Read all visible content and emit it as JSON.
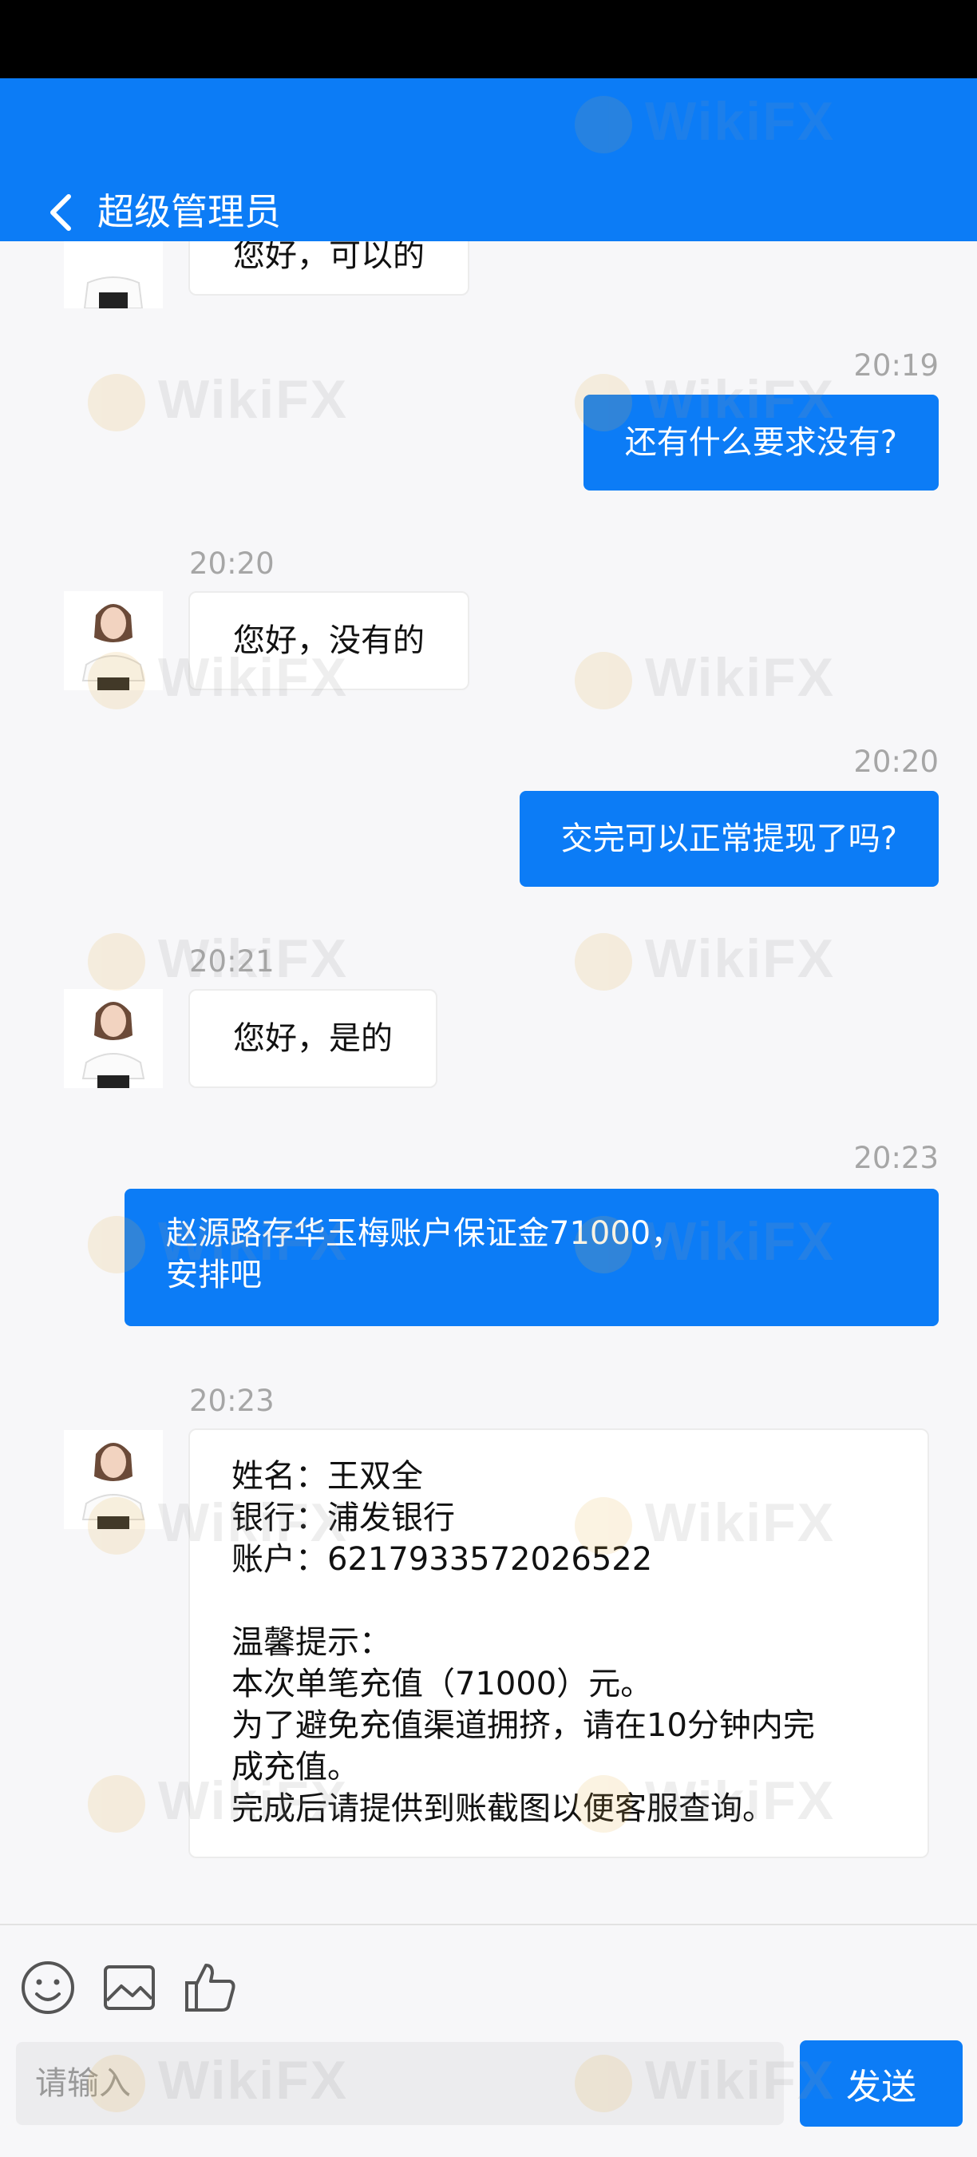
{
  "header": {
    "title": "超级管理员"
  },
  "messages": [
    {
      "side": "in",
      "time": "",
      "text": "您好，可以的"
    },
    {
      "side": "out",
      "time": "20:19",
      "text": "还有什么要求没有?"
    },
    {
      "side": "in",
      "time": "20:20",
      "text": "您好，没有的"
    },
    {
      "side": "out",
      "time": "20:20",
      "text": "交完可以正常提现了吗?"
    },
    {
      "side": "in",
      "time": "20:21",
      "text": "您好，是的"
    },
    {
      "side": "out",
      "time": "20:23",
      "text": "赵源路存华玉梅账户保证金71000，\n安排吧"
    },
    {
      "side": "in",
      "time": "20:23",
      "text": "姓名：王双全\n银行：浦发银行\n账户：6217933572026522\n\n温馨提示：\n本次单笔充值（71000）元。\n为了避免充值渠道拥挤，请在10分钟内完\n成充值。\n完成后请提供到账截图以便客服查询。"
    }
  ],
  "composer": {
    "placeholder": "请输入",
    "send_label": "发送",
    "icons": [
      "emoji-icon",
      "image-icon",
      "thumbs-up-icon"
    ]
  },
  "watermark": {
    "text": "WikiFX"
  },
  "colors": {
    "brand": "#0c7cf6",
    "background": "#f7f7f9"
  }
}
